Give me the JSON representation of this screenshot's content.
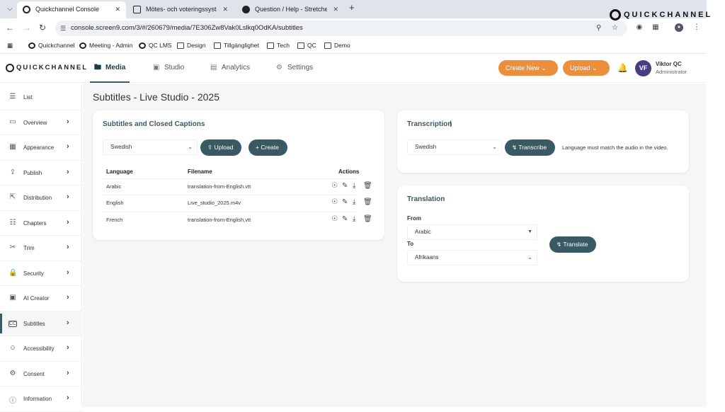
{
  "browser": {
    "tabs": [
      {
        "title": "Quickchannel Console"
      },
      {
        "title": "Mötes- och voteringssystem | C"
      },
      {
        "title": "Question / Help - Stretched gui"
      }
    ],
    "brand": "QUICKCHANNEL",
    "url": "console.screen9.com/3/#/260679/media/7E306Zw8Vak0Lslkq0OdKA/subtitles",
    "bookmarks": [
      "Quickchannel",
      "Meeting - Admin",
      "QC LMS",
      "Design",
      "Tillgänglighet",
      "Tech",
      "QC",
      "Demo"
    ]
  },
  "app": {
    "logo": "QUICKCHANNEL",
    "nav": [
      {
        "label": "Media",
        "icon": "folder-icon"
      },
      {
        "label": "Studio",
        "icon": "studio-icon"
      },
      {
        "label": "Analytics",
        "icon": "chart-icon"
      },
      {
        "label": "Settings",
        "icon": "gear-icon"
      }
    ],
    "create_new": "Create New",
    "upload": "Upload",
    "user": {
      "initials": "VF",
      "name": "Viktor QC",
      "role": "Administrator"
    }
  },
  "sidebar": {
    "items": [
      {
        "label": "List"
      },
      {
        "label": "Overview"
      },
      {
        "label": "Appearance"
      },
      {
        "label": "Publish"
      },
      {
        "label": "Distribution"
      },
      {
        "label": "Chapters"
      },
      {
        "label": "Trim"
      },
      {
        "label": "Security"
      },
      {
        "label": "AI Creator"
      },
      {
        "label": "Subtitles"
      },
      {
        "label": "Accessibility"
      },
      {
        "label": "Consent"
      },
      {
        "label": "Information"
      }
    ]
  },
  "page": {
    "title": "Subtitles  -  Live Studio - 2025"
  },
  "subtitles": {
    "title": "Subtitles and Closed Captions",
    "language": "Swedish",
    "upload_label": "Upload",
    "create_label": "Create",
    "headers": {
      "language": "Language",
      "filename": "Filename",
      "actions": "Actions"
    },
    "rows": [
      {
        "language": "Arabic",
        "filename": "translation-from-English.vtt"
      },
      {
        "language": "English",
        "filename": "Live_studio_2025.m4v"
      },
      {
        "language": "French",
        "filename": "translation-from-English.vtt"
      }
    ]
  },
  "transcription": {
    "title": "Transcription",
    "language": "Swedish",
    "button": "Transcribe",
    "hint": "Language must match the audio in the video."
  },
  "translation": {
    "title": "Translation",
    "from_label": "From",
    "from_value": "Arabic",
    "to_label": "To",
    "to_value": "Afrikaans",
    "button": "Translate"
  },
  "colors": {
    "accent": "#3a5a63",
    "orange": "#ec8f3d",
    "avatar": "#4b3a84"
  }
}
